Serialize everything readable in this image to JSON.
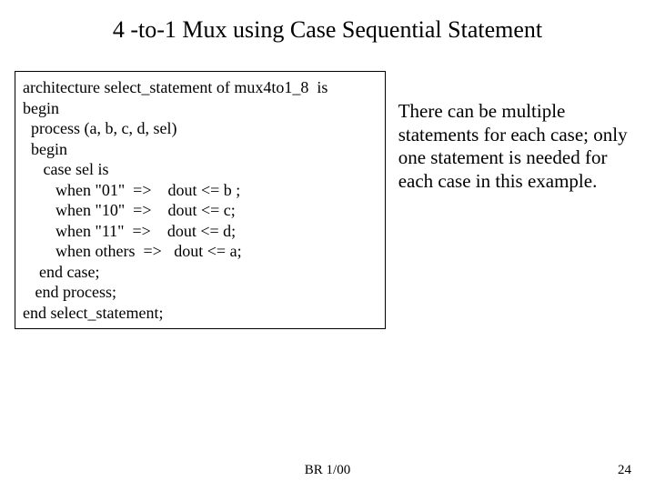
{
  "title": "4 -to-1 Mux using Case Sequential Statement",
  "code": {
    "l1": "architecture select_statement of mux4to1_8  is",
    "l2": "begin",
    "l3": "",
    "l4": "  process (a, b, c, d, sel)",
    "l5": "  begin",
    "l6": "     case sel is",
    "l7": "        when \"01\"  =>    dout <= b ;",
    "l8": "        when \"10\"  =>    dout <= c;",
    "l9": "        when \"11\"  =>    dout <= d;",
    "l10": "        when others  =>   dout <= a;",
    "l11": "    end case;",
    "l12": "   end process;",
    "l13": "end select_statement;"
  },
  "explain": "There can be multiple statements for each case; only one statement is needed for each case in this example.",
  "footer": {
    "left": "BR 1/00",
    "right": "24"
  }
}
